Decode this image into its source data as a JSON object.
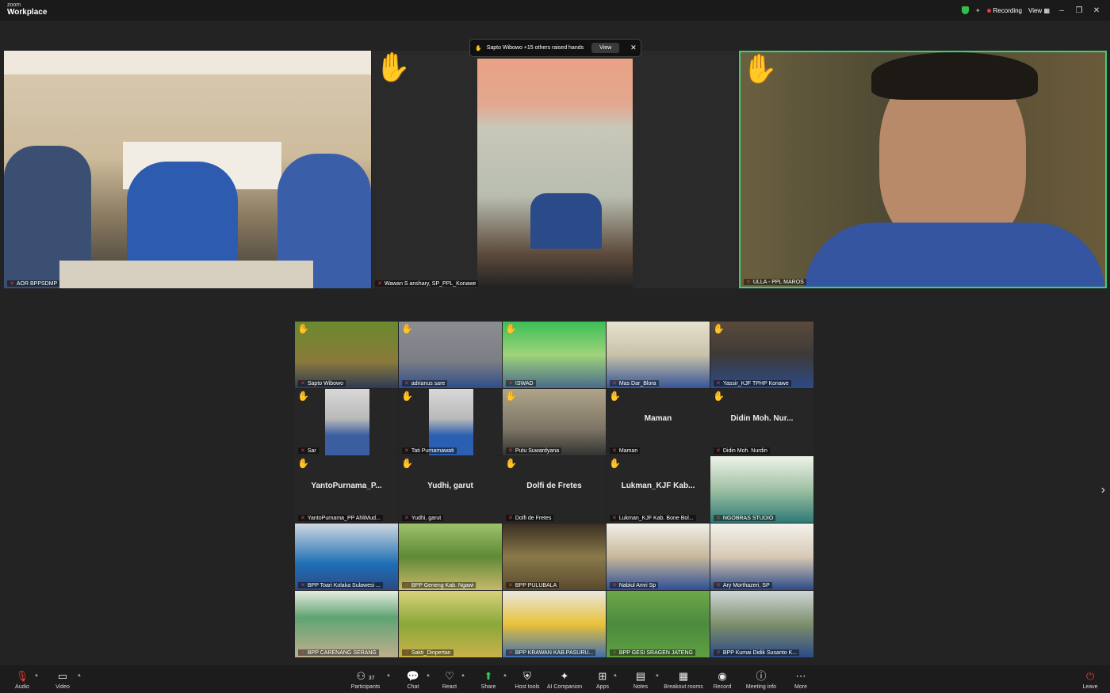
{
  "app": {
    "brand_small": "zoom",
    "brand_big": "Workplace"
  },
  "titlebar": {
    "recording": "Recording",
    "view": "View"
  },
  "notice": {
    "text": "Sapto Wibowo +15 others raised hands",
    "button": "View"
  },
  "top_tiles": [
    {
      "name": "AOR BPPSDMP"
    },
    {
      "name": "Wawan S anshary, SP_PPL_Konawe"
    },
    {
      "name": "ULLA - PPL MAROS"
    }
  ],
  "grid": [
    {
      "name": "Sapto Wibowo"
    },
    {
      "name": "adrianus sare"
    },
    {
      "name": "ISWAD"
    },
    {
      "name": "Mas Dar_Blora"
    },
    {
      "name": "Yassir_KJF TPHP Konawe"
    },
    {
      "name": "Sar"
    },
    {
      "name": "Tati Purnamawati"
    },
    {
      "name": "Putu Suwardyana"
    },
    {
      "name": "Maman",
      "display": "Maman"
    },
    {
      "name": "Didin Moh. Nurdin",
      "display": "Didin Moh. Nur..."
    },
    {
      "name": "YantoPurnama_PP AhliMud...",
      "display": "YantoPurnama_P..."
    },
    {
      "name": "Yudhi, garut",
      "display": "Yudhi, garut"
    },
    {
      "name": "Dolfi de Fretes",
      "display": "Dolfi de Fretes"
    },
    {
      "name": "Lukman_KJF Kab. Bone Bol...",
      "display": "Lukman_KJF  Kab..."
    },
    {
      "name": "NGOBRAS STUDIO"
    },
    {
      "name": "BPP Toari Kolaka Sulawesi ..."
    },
    {
      "name": "BPP Geneng Kab. Ngawi"
    },
    {
      "name": "BPP PULUBALA"
    },
    {
      "name": "Nabiul Amri Sp"
    },
    {
      "name": "Ary Morthazeri, SP"
    },
    {
      "name": "BPP CARENANG SERANG"
    },
    {
      "name": "Sakti_Dinpertan"
    },
    {
      "name": "BPP KRAWAN KAB.PASURU..."
    },
    {
      "name": "BPP GESI  SRAGEN  JATENG"
    },
    {
      "name": "BPP Kumai Didik Susanto K..."
    }
  ],
  "toolbar": {
    "audio": "Audio",
    "video": "Video",
    "participants": "Participants",
    "participants_count": "37",
    "chat": "Chat",
    "react": "React",
    "share": "Share",
    "host_tools": "Host tools",
    "ai_companion": "AI Companion",
    "apps": "Apps",
    "notes": "Notes",
    "breakout_rooms": "Breakout rooms",
    "record": "Record",
    "meeting_info": "Meeting info",
    "more": "More",
    "leave": "Leave"
  },
  "colors": {
    "active_speaker": "#3ccf7a",
    "raised_hand": "#f5c542",
    "muted": "#e53935",
    "share": "#36c75a"
  }
}
